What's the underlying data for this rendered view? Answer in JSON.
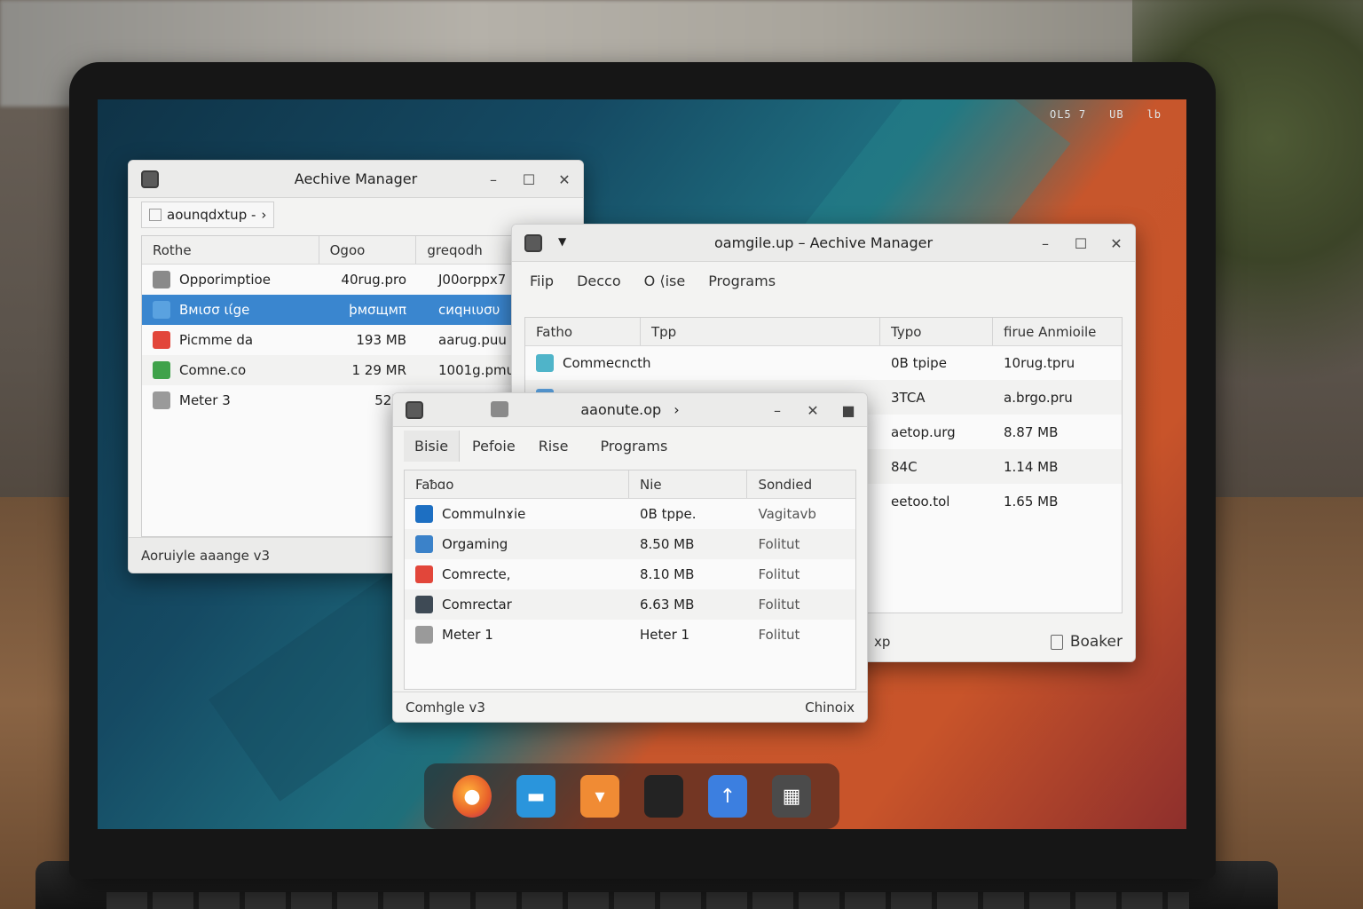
{
  "tray": [
    "OL5 7",
    "UB",
    "lb"
  ],
  "win1": {
    "title": "Aechive Manager",
    "path": "aounqdxtup -",
    "columns": [
      "Rothe",
      "Ogoo",
      "greqodh"
    ],
    "rows": [
      {
        "name": "Opporimptioe",
        "size": "40rug.pro",
        "type": "J00orppx7",
        "color": "#8a8a8a"
      },
      {
        "name": "Bмισσ ιίge",
        "size": "ϸмσщмπ",
        "type": "cиqнιυσυ",
        "color": "#5aa2e0",
        "selected": true
      },
      {
        "name": "Picmme da",
        "size": "193 MB",
        "type": "aarug.puu",
        "color": "#e2463a"
      },
      {
        "name": "Comne.co",
        "size": "1 29 MR",
        "type": "1001g.pmu",
        "color": "#3fa24a"
      },
      {
        "name": "Meter 3",
        "size": "52ilij",
        "type": "",
        "color": "#9a9a9a"
      }
    ],
    "status": "Aoruiyle aaange v3"
  },
  "win2": {
    "title": "oamgile.up – Aechive Manager",
    "menu": [
      "Fiip",
      "Decco",
      "O ⟨ise",
      "Programs"
    ],
    "columns": [
      "Fatho",
      "Tpp",
      "Typo",
      "firue Anmioile"
    ],
    "rows": [
      {
        "name": "Commecncth",
        "type": "0B tpipe",
        "size": "10rug.tpru",
        "color": "#4fb4c9"
      },
      {
        "name": "",
        "type": "3TCA",
        "size": "a.brgo.pru",
        "color": "#5aa2e0"
      },
      {
        "name": "",
        "type": "aetop.urg",
        "size": "8.87 MB",
        "color": ""
      },
      {
        "name": "",
        "type": "84C",
        "size": "1.14 MB",
        "color": ""
      },
      {
        "name": "",
        "type": "eetoo.tol",
        "size": "1.65 MB",
        "color": ""
      }
    ],
    "status_left": "xp",
    "status_right": "Boaker"
  },
  "win3": {
    "title": "aaonute.op",
    "menu": [
      "Bisie",
      "Pefoie",
      "Rise",
      "Programs"
    ],
    "columns": [
      "Faᵬɑo",
      "Nie",
      "Sondied"
    ],
    "rows": [
      {
        "name": "Commulnɤie",
        "size": "0B tppe.",
        "modified": "Vagitavb",
        "color": "#1d6fc2"
      },
      {
        "name": "Orgaming",
        "size": "8.50 MB",
        "modified": "Folitut",
        "color": "#3b82c9"
      },
      {
        "name": "Comrecte,",
        "size": "8.10 MB",
        "modified": "Folitut",
        "color": "#e2463a"
      },
      {
        "name": "Comrectar",
        "size": "6.63 MB",
        "modified": "Folitut",
        "color": "#3e4a55"
      },
      {
        "name": "Meter 1",
        "size": "Heter 1",
        "modified": "Folitut",
        "color": "#9a9a9a"
      }
    ],
    "status_left": "Comhgle v3",
    "status_right": "Chinoix"
  },
  "dock": [
    {
      "name": "firefox-icon",
      "color": "#e8602a"
    },
    {
      "name": "files-icon",
      "color": "#2a95dc"
    },
    {
      "name": "archive-icon",
      "color": "#f08b34"
    },
    {
      "name": "terminal-icon",
      "color": "#232323"
    },
    {
      "name": "upload-icon",
      "color": "#3c7fe0"
    },
    {
      "name": "app-grid-icon",
      "color": "#4b4b4b"
    }
  ]
}
